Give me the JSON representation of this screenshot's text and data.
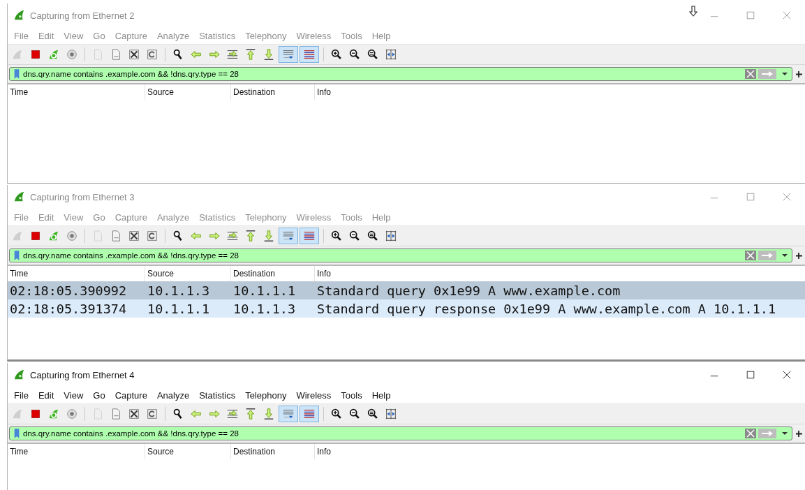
{
  "windows": [
    {
      "title": "Capturing from Ethernet 2",
      "active": false,
      "menu": [
        "File",
        "Edit",
        "View",
        "Go",
        "Capture",
        "Analyze",
        "Statistics",
        "Telephony",
        "Wireless",
        "Tools",
        "Help"
      ],
      "toolbar": [
        {
          "kind": "fin",
          "disabled": true,
          "on": false
        },
        {
          "kind": "stop",
          "disabled": false,
          "on": false
        },
        {
          "kind": "restart",
          "disabled": false,
          "on": false
        },
        {
          "kind": "gear",
          "disabled": false,
          "on": false
        },
        {
          "kind": "separator"
        },
        {
          "kind": "open",
          "disabled": true,
          "on": false
        },
        {
          "kind": "save",
          "disabled": false,
          "on": false
        },
        {
          "kind": "close",
          "disabled": false,
          "on": false
        },
        {
          "kind": "reload",
          "disabled": false,
          "on": false
        },
        {
          "kind": "separator"
        },
        {
          "kind": "find",
          "disabled": false,
          "on": false
        },
        {
          "kind": "back",
          "disabled": false,
          "on": false
        },
        {
          "kind": "forward",
          "disabled": false,
          "on": false
        },
        {
          "kind": "jump",
          "disabled": false,
          "on": false
        },
        {
          "kind": "first",
          "disabled": false,
          "on": false
        },
        {
          "kind": "last",
          "disabled": false,
          "on": false
        },
        {
          "kind": "autoscroll",
          "disabled": false,
          "on": true
        },
        {
          "kind": "colorize",
          "disabled": false,
          "on": true
        },
        {
          "kind": "separator"
        },
        {
          "kind": "zoomin",
          "disabled": false,
          "on": false
        },
        {
          "kind": "zoomout",
          "disabled": false,
          "on": false
        },
        {
          "kind": "zoomreset",
          "disabled": false,
          "on": false
        },
        {
          "kind": "resize",
          "disabled": false,
          "on": false
        }
      ],
      "filter": {
        "value": "dns.qry.name contains .example.com && !dns.qry.type == 28"
      },
      "columns": [
        "Time",
        "Source",
        "Destination",
        "Info"
      ]
    },
    {
      "title": "Capturing from Ethernet 3",
      "active": false,
      "menu": [
        "File",
        "Edit",
        "View",
        "Go",
        "Capture",
        "Analyze",
        "Statistics",
        "Telephony",
        "Wireless",
        "Tools",
        "Help"
      ],
      "toolbar": [
        {
          "kind": "fin",
          "disabled": true,
          "on": false
        },
        {
          "kind": "stop",
          "disabled": false,
          "on": false
        },
        {
          "kind": "restart",
          "disabled": false,
          "on": false
        },
        {
          "kind": "gear",
          "disabled": false,
          "on": false
        },
        {
          "kind": "separator"
        },
        {
          "kind": "open",
          "disabled": true,
          "on": false
        },
        {
          "kind": "save",
          "disabled": false,
          "on": false
        },
        {
          "kind": "close",
          "disabled": false,
          "on": false
        },
        {
          "kind": "reload",
          "disabled": false,
          "on": false
        },
        {
          "kind": "separator"
        },
        {
          "kind": "find",
          "disabled": false,
          "on": false
        },
        {
          "kind": "back",
          "disabled": false,
          "on": false
        },
        {
          "kind": "forward",
          "disabled": false,
          "on": false
        },
        {
          "kind": "jump",
          "disabled": false,
          "on": false
        },
        {
          "kind": "first",
          "disabled": false,
          "on": false
        },
        {
          "kind": "last",
          "disabled": false,
          "on": false
        },
        {
          "kind": "autoscroll",
          "disabled": false,
          "on": true
        },
        {
          "kind": "colorize",
          "disabled": false,
          "on": true
        },
        {
          "kind": "separator"
        },
        {
          "kind": "zoomin",
          "disabled": false,
          "on": false
        },
        {
          "kind": "zoomout",
          "disabled": false,
          "on": false
        },
        {
          "kind": "zoomreset",
          "disabled": false,
          "on": false
        },
        {
          "kind": "resize",
          "disabled": false,
          "on": false
        }
      ],
      "filter": {
        "value": "dns.qry.name contains .example.com && !dns.qry.type == 28"
      },
      "columns": [
        "Time",
        "Source",
        "Destination",
        "Info"
      ],
      "rows": [
        {
          "selected": true,
          "cells": [
            "02:18:05.390992",
            "10.1.1.3",
            "10.1.1.1",
            "Standard query 0x1e99 A www.example.com"
          ]
        },
        {
          "selected": false,
          "cells": [
            "02:18:05.391374",
            "10.1.1.1",
            "10.1.1.3",
            "Standard query response 0x1e99 A www.example.com A 10.1.1.1"
          ]
        }
      ]
    },
    {
      "title": "Capturing from Ethernet 4",
      "active": true,
      "menu": [
        "File",
        "Edit",
        "View",
        "Go",
        "Capture",
        "Analyze",
        "Statistics",
        "Telephony",
        "Wireless",
        "Tools",
        "Help"
      ],
      "toolbar": [
        {
          "kind": "fin",
          "disabled": true,
          "on": false
        },
        {
          "kind": "stop",
          "disabled": false,
          "on": false
        },
        {
          "kind": "restart",
          "disabled": false,
          "on": false
        },
        {
          "kind": "gear",
          "disabled": false,
          "on": false
        },
        {
          "kind": "separator"
        },
        {
          "kind": "open",
          "disabled": true,
          "on": false
        },
        {
          "kind": "save",
          "disabled": false,
          "on": false
        },
        {
          "kind": "close",
          "disabled": false,
          "on": false
        },
        {
          "kind": "reload",
          "disabled": false,
          "on": false
        },
        {
          "kind": "separator"
        },
        {
          "kind": "find",
          "disabled": false,
          "on": false
        },
        {
          "kind": "back",
          "disabled": false,
          "on": false
        },
        {
          "kind": "forward",
          "disabled": false,
          "on": false
        },
        {
          "kind": "jump",
          "disabled": false,
          "on": false
        },
        {
          "kind": "first",
          "disabled": false,
          "on": false
        },
        {
          "kind": "last",
          "disabled": false,
          "on": false
        },
        {
          "kind": "autoscroll",
          "disabled": false,
          "on": true
        },
        {
          "kind": "colorize",
          "disabled": false,
          "on": true
        },
        {
          "kind": "separator"
        },
        {
          "kind": "zoomin",
          "disabled": false,
          "on": false
        },
        {
          "kind": "zoomout",
          "disabled": false,
          "on": false
        },
        {
          "kind": "zoomreset",
          "disabled": false,
          "on": false
        },
        {
          "kind": "resize",
          "disabled": false,
          "on": false
        }
      ],
      "filter": {
        "value": "dns.qry.name contains .example.com && !dns.qry.type == 28"
      },
      "columns": [
        "Time",
        "Source",
        "Destination",
        "Info"
      ]
    }
  ]
}
